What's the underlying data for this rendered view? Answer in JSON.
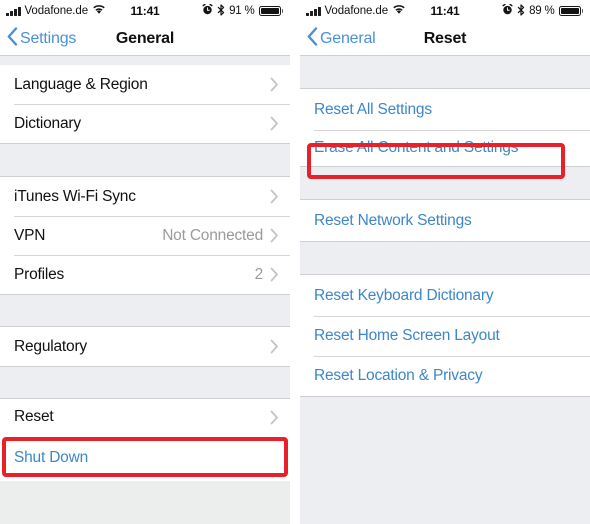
{
  "colors": {
    "highlight": "#e8202a",
    "link_blue": "#3d87c9",
    "nav_blue": "#4a90d9",
    "group_bg": "#eceef2",
    "row_bg": "#ffffff",
    "value_gray": "#9a9a9f"
  },
  "left_screen": {
    "status_bar": {
      "carrier": "Vodafone.de",
      "time": "11:41",
      "battery_percent": "91 %",
      "icons": [
        "signal-bars-icon",
        "wifi-icon",
        "alarm-clock-icon",
        "bluetooth-icon",
        "battery-icon"
      ]
    },
    "nav": {
      "back_label": "Settings",
      "title": "General"
    },
    "sections": [
      {
        "rows": [
          {
            "label": "Language & Region",
            "value": "",
            "accessory": "chevron"
          },
          {
            "label": "Dictionary",
            "value": "",
            "accessory": "chevron"
          }
        ]
      },
      {
        "rows": [
          {
            "label": "iTunes Wi-Fi Sync",
            "value": "",
            "accessory": "chevron"
          },
          {
            "label": "VPN",
            "value": "Not Connected",
            "accessory": "chevron"
          },
          {
            "label": "Profiles",
            "value": "2",
            "accessory": "chevron"
          }
        ]
      },
      {
        "rows": [
          {
            "label": "Regulatory",
            "value": "",
            "accessory": "chevron"
          }
        ]
      },
      {
        "rows": [
          {
            "label": "Reset",
            "value": "",
            "accessory": "chevron",
            "highlighted": true
          }
        ]
      },
      {
        "rows": [
          {
            "label": "Shut Down",
            "value": "",
            "accessory": "none",
            "link": true
          }
        ]
      }
    ]
  },
  "right_screen": {
    "status_bar": {
      "carrier": "Vodafone.de",
      "time": "11:41",
      "battery_percent": "89 %",
      "icons": [
        "signal-bars-icon",
        "wifi-icon",
        "alarm-clock-icon",
        "bluetooth-icon",
        "battery-icon"
      ]
    },
    "nav": {
      "back_label": "General",
      "title": "Reset"
    },
    "sections": [
      {
        "rows": [
          {
            "label": "Reset All Settings",
            "link": true
          },
          {
            "label": "Erase All Content and Settings",
            "link": true,
            "highlighted": true
          }
        ]
      },
      {
        "rows": [
          {
            "label": "Reset Network Settings",
            "link": true
          }
        ]
      },
      {
        "rows": [
          {
            "label": "Reset Keyboard Dictionary",
            "link": true
          },
          {
            "label": "Reset Home Screen Layout",
            "link": true
          },
          {
            "label": "Reset Location & Privacy",
            "link": true
          }
        ]
      }
    ]
  }
}
